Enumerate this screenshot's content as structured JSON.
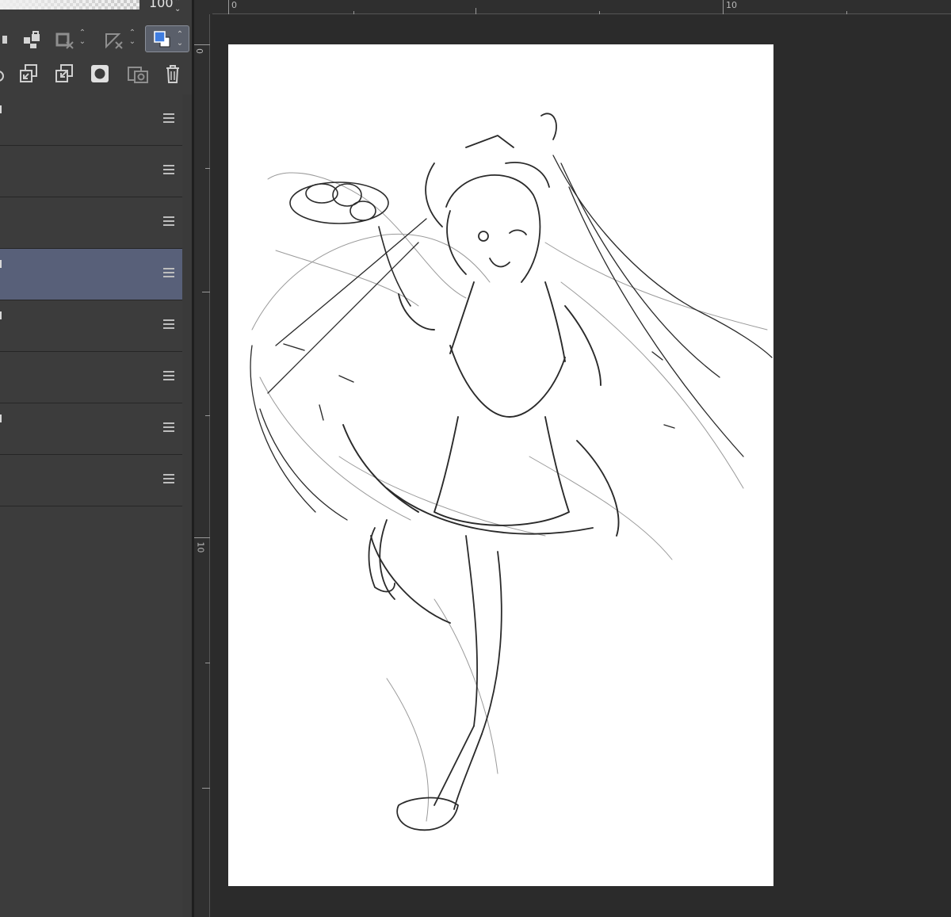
{
  "layer_panel": {
    "opacity_value": "100",
    "layers": [
      {
        "selected": false
      },
      {
        "selected": false
      },
      {
        "selected": false
      },
      {
        "selected": true
      },
      {
        "selected": false
      },
      {
        "selected": false
      },
      {
        "selected": false
      },
      {
        "selected": false
      }
    ]
  },
  "rulers": {
    "top_labels": [
      "0",
      "10"
    ],
    "left_labels": [
      "0",
      "10"
    ]
  },
  "colors": {
    "panel_bg": "#3c3c3c",
    "selected_layer": "#586079",
    "canvas_bg": "#2b2b2b",
    "paper": "#ffffff"
  }
}
